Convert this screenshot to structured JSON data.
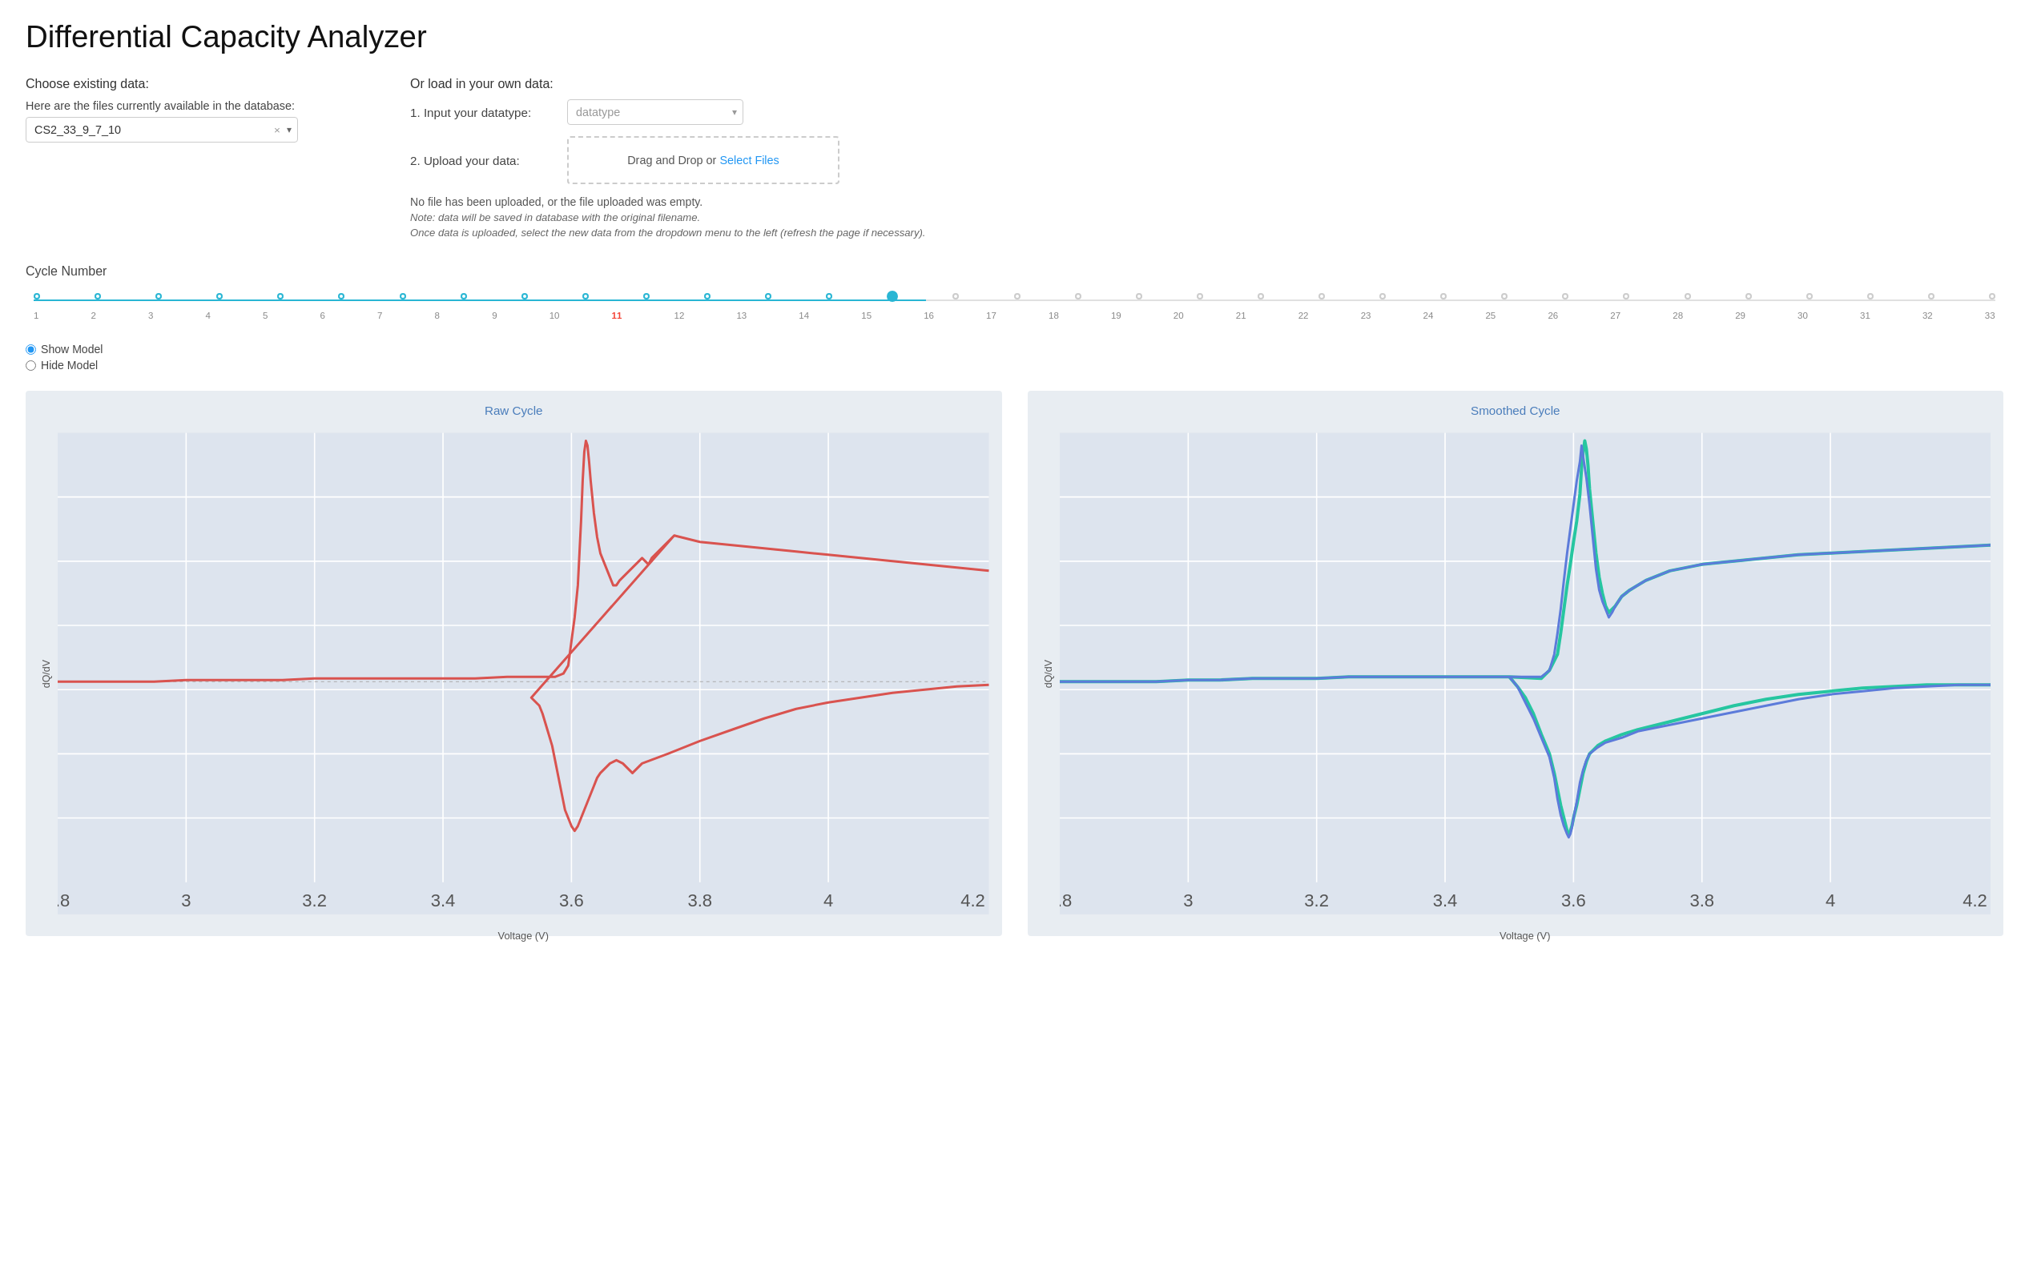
{
  "page": {
    "title": "Differential Capacity Analyzer"
  },
  "left": {
    "section_title": "Choose existing data:",
    "files_label": "Here are the files currently available in the database:",
    "selected_file": "CS2_33_9_7_10",
    "clear_symbol": "×",
    "dropdown_arrow": "▾"
  },
  "right": {
    "section_title": "Or load in your own data:",
    "step1_label": "1. Input your datatype:",
    "datatype_placeholder": "datatype",
    "step2_label": "2. Upload your data:",
    "upload_text": "Drag and Drop or ",
    "upload_link": "Select Files",
    "upload_note": "No file has been uploaded, or the file uploaded was empty.",
    "upload_note2": "Note: data will be saved in database with the original filename.",
    "upload_note3": "Once data is uploaded, select the new data from the dropdown menu to the left (refresh the page if necessary)."
  },
  "cycle": {
    "label": "Cycle Number",
    "numbers": [
      "1",
      "2",
      "3",
      "4",
      "5",
      "6",
      "7",
      "8",
      "9",
      "10",
      "11",
      "12",
      "13",
      "14",
      "15",
      "16",
      "17",
      "18",
      "19",
      "20",
      "21",
      "22",
      "23",
      "24",
      "25",
      "26",
      "27",
      "28",
      "29",
      "30",
      "31",
      "32",
      "33"
    ],
    "active_index": 14,
    "highlight_indices": [
      10
    ]
  },
  "radio": {
    "show_model": "Show Model",
    "hide_model": "Hide Model",
    "selected": "show"
  },
  "raw_chart": {
    "title": "Raw Cycle",
    "x_label": "Voltage (V)",
    "y_label": "dQ/dV"
  },
  "smoothed_chart": {
    "title": "Smoothed Cycle",
    "x_label": "Voltage (V)",
    "y_label": "dQ/dV"
  }
}
